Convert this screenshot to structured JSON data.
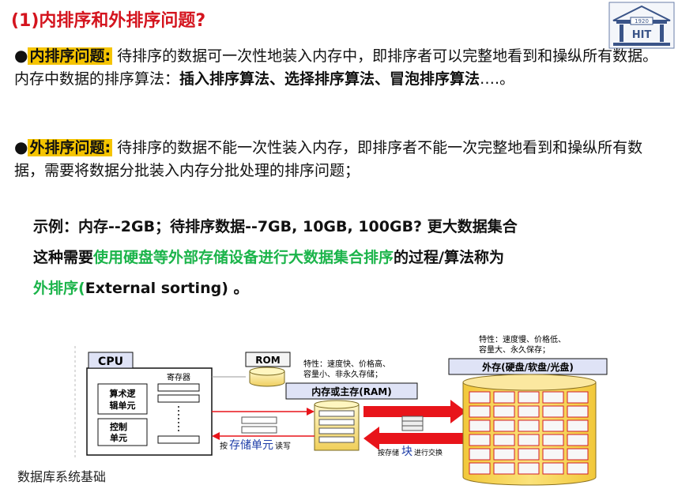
{
  "title": "(1)内排序和外排序问题?",
  "internal": {
    "bullet": "●",
    "term": "内排序问题:",
    "text1": " 待排序的数据可一次性地装入内存中，即排序者可以完整地看到和操纵所有数据。内存中数据的排序算法：",
    "algos": "插入排序算法、选择排序算法、冒泡排序算法",
    "ellipsis": "….。"
  },
  "external": {
    "bullet": "●",
    "term": "外排序问题:",
    "text1": " 待排序的数据不能一次性装入内存，即排序者不能一次完整地看到和操纵所有数据，需要将数据分批装入内存分批处理的排序问题；"
  },
  "example": {
    "line1": "示例：内存--2GB；待排序数据--7GB, 10GB, 100GB? 更大数据集合",
    "line2_a": "这种需要",
    "line2_green": "使用硬盘等外部存储设备进行大数据集合排序",
    "line2_b": "的过程/算法称为",
    "line3_green": "外排序(",
    "line3_b": "External sorting) 。"
  },
  "diagram": {
    "cpu": "CPU",
    "registers": "寄存器",
    "alu1": "算术逻",
    "alu2": "辑单元",
    "ctrl1": "控制",
    "ctrl2": "单元",
    "rom": "ROM",
    "ram_features1": "特性：速度快、价格高、",
    "ram_features2": "容量小、非永久存储；",
    "ram": "内存或主存(RAM)",
    "ext_features1": "特性：速度慢、价格低、",
    "ext_features2": "容量大、永久保存；",
    "ext": "外存(硬盘/软盘/光盘)",
    "rw_pre": "按",
    "rw_unit": "存储单元",
    "rw_post": "读写",
    "blk_pre": "按存储",
    "blk_unit": "块",
    "blk_post": "进行交换"
  },
  "logo": {
    "year": "1920",
    "letters": "HIT"
  },
  "footer": "数据库系统基础",
  "colors": {
    "title": "#d4141e",
    "highlight": "#f5c400",
    "green": "#1bb44a",
    "arrow": "#e8141a",
    "blue": "#1e3ea8"
  }
}
